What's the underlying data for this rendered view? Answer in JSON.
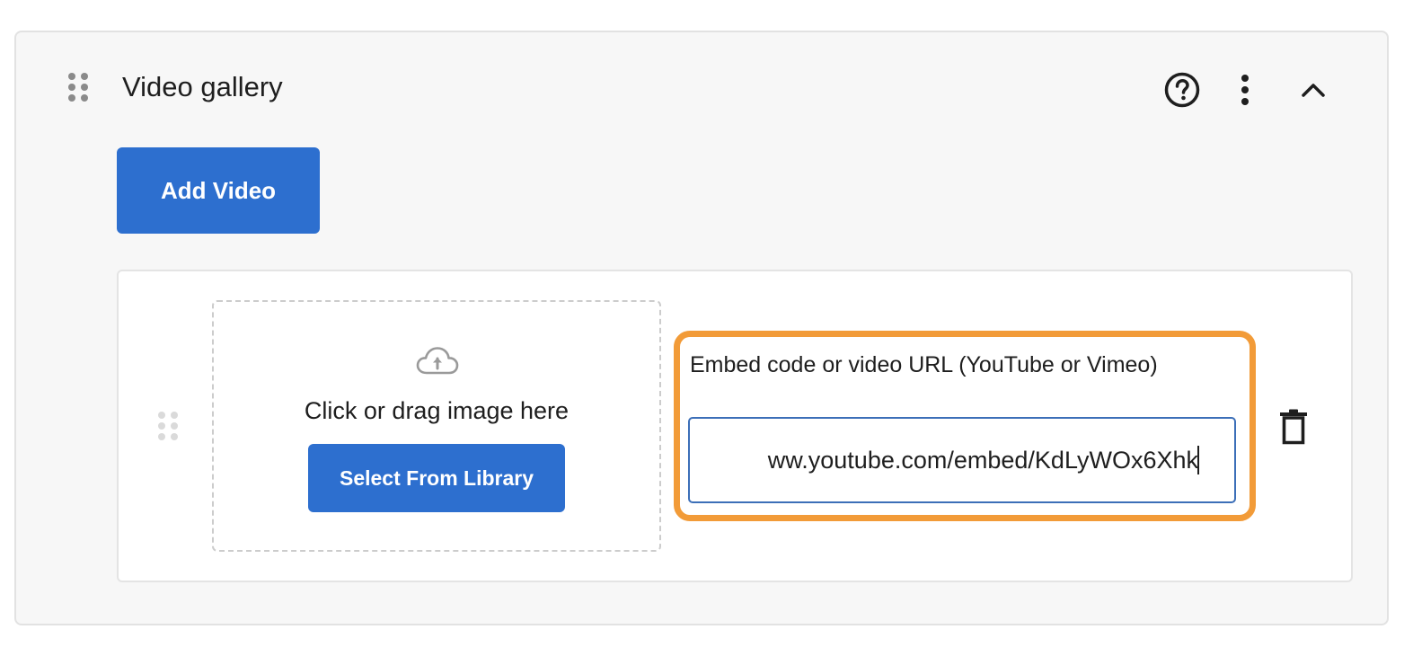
{
  "panel": {
    "title": "Video gallery",
    "icons": {
      "drag": "drag-handle-icon",
      "help": "help-circle-icon",
      "menu": "more-vertical-icon",
      "collapse": "chevron-up-icon"
    }
  },
  "add_video_label": "Add Video",
  "video_item": {
    "dropzone_text": "Click or drag image here",
    "upload_icon": "cloud-upload-icon",
    "library_button_label": "Select From Library",
    "embed_label": "Embed code or video URL (YouTube or Vimeo)",
    "embed_value": "ww.youtube.com/embed/KdLyWOx6Xhk",
    "delete_icon": "trash-icon"
  },
  "colors": {
    "primary": "#2d6fcf",
    "highlight": "#f29b38",
    "input_border": "#3c6fb8",
    "panel_bg": "#f7f7f7"
  }
}
